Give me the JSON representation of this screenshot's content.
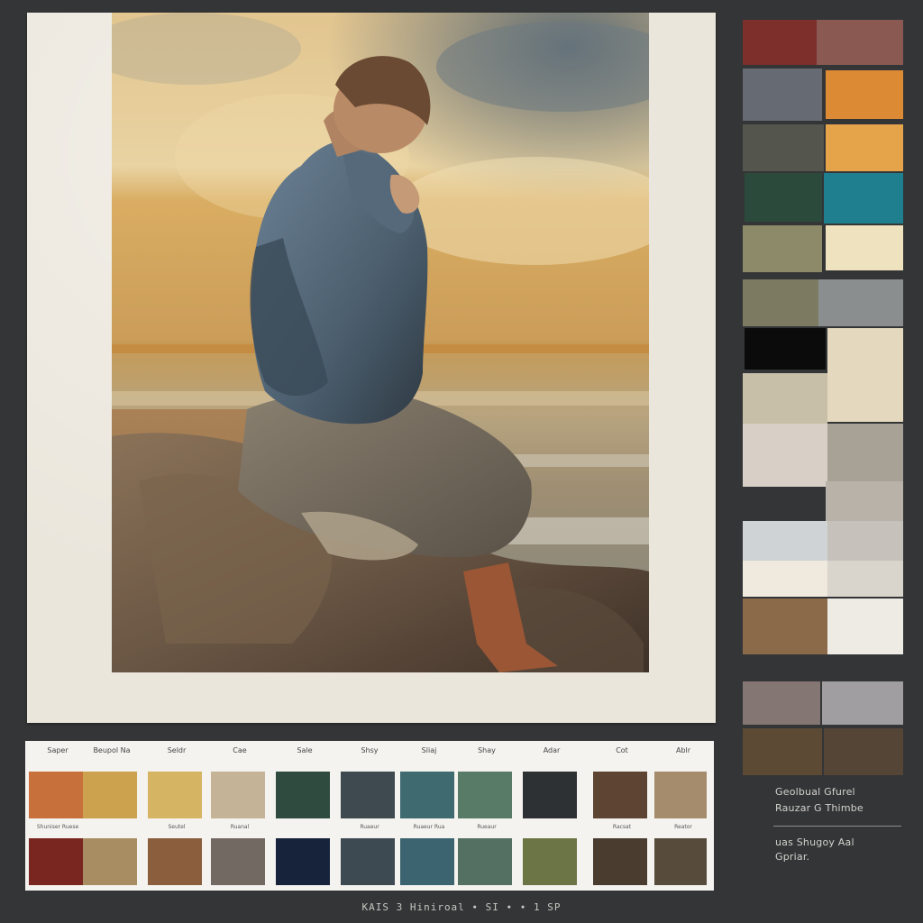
{
  "artwork": {
    "colors": {
      "sky_light": "#e6cf9a",
      "sky_gold": "#d8ad63",
      "cloud_gray": "#6f7a80",
      "sea_band": "#b9a57c",
      "rock": "#6e5a46",
      "shirt": "#4f6272",
      "trousers": "#786e62",
      "hair": "#6a4a33",
      "boot": "#9c5a38"
    }
  },
  "side_palette": {
    "swatches": [
      "#7c2f2b",
      "#8a5a52",
      "#666a72",
      "#dc8a34",
      "#54554d",
      "#e6a44a",
      "#2b4a3c",
      "#1f7f8e",
      "#8d8a6a",
      "#eee2bf",
      "#7d7a62",
      "#8a8e8e",
      "#0b0b0b",
      "#e4d8bf",
      "#c7bfa8",
      "#a7a295",
      "#d8d0c6",
      "#b8b2a8",
      "#cfd3d6",
      "#c6c2bb",
      "#efe9de",
      "#d9d4cc",
      "#8b6a4a",
      "#eeebe4",
      "#847673",
      "#a09ea0",
      "#5c4a34",
      "#544537"
    ],
    "caption_1": "Geolbual Gfurel",
    "caption_2": "Rauzar G Thimbe",
    "caption_3": "uas Shugoy Aal",
    "caption_4": "Gpriar."
  },
  "swatch_card": {
    "header_labels": [
      "Saper",
      "Beupol Na",
      "Seldr",
      "Cae",
      "Sale",
      "Shsy",
      "Sliaj",
      "Shay",
      "Adar",
      "Cot",
      "Ablr"
    ],
    "mid_labels": [
      "Shuniser Ruese",
      "",
      "Seutel",
      "Ruanal",
      "",
      "Ruaeur",
      "Ruaeur Rua",
      "Rueaur",
      "",
      "Racsat",
      "Reator"
    ],
    "row_1": [
      "#c7703c",
      "#cda24f",
      "#d5b463",
      "#c4b396",
      "#2f4a3f",
      "#3e4a50",
      "#3f6a70",
      "#577b66",
      "#2e3133",
      "#5e4533",
      "#a58c6c"
    ],
    "row_2": [
      "#7a2620",
      "#a98d62",
      "#8b5f3d",
      "#726a62",
      "#16233b",
      "#3e4a52",
      "#3c6470",
      "#537062",
      "#6b7546",
      "#4a3d30",
      "#574b3c"
    ]
  },
  "footer": {
    "text": "KAIS 3 Hiniroal ∙ SI ∙ ∙ 1 SP"
  }
}
